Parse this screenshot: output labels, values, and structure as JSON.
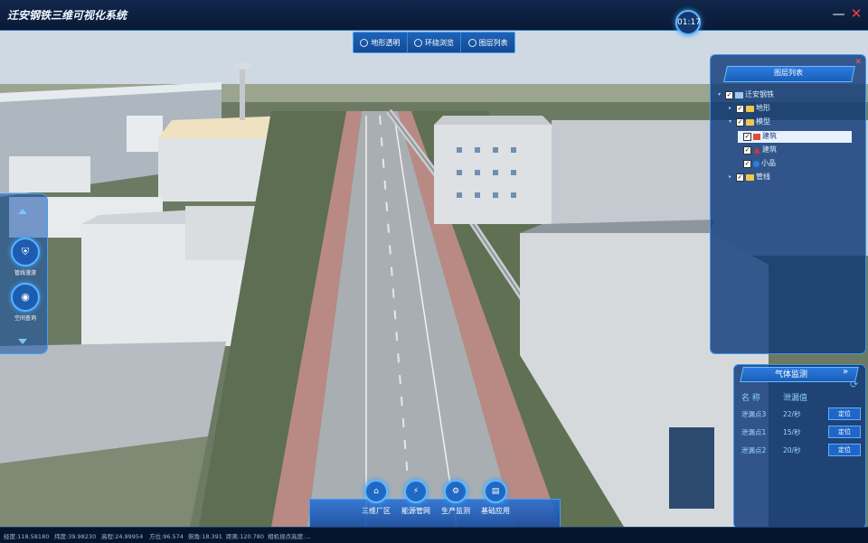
{
  "app": {
    "title": "迁安钢铁三维可视化系统",
    "clock": "01:17"
  },
  "window_controls": {
    "minimize": "—",
    "close": "✕"
  },
  "toolbar": [
    {
      "label": "地形透明",
      "icon": "terrain-icon"
    },
    {
      "label": "环绕浏览",
      "icon": "orbit-icon"
    },
    {
      "label": "图层列表",
      "icon": "layers-icon"
    }
  ],
  "left_nav": {
    "items": [
      {
        "label": "管线漫游",
        "icon": "pipeline-icon"
      },
      {
        "label": "空间查询",
        "icon": "eye-icon"
      }
    ]
  },
  "layer_panel": {
    "title": "图层列表",
    "close": "✕",
    "tree": [
      {
        "label": "迁安钢铁",
        "level": 0,
        "checked": true,
        "expanded": true,
        "icon": "root-icon"
      },
      {
        "label": "地形",
        "level": 1,
        "checked": true,
        "expanded": false,
        "icon": "folder-icon"
      },
      {
        "label": "模型",
        "level": 1,
        "checked": true,
        "expanded": true,
        "icon": "folder-icon"
      },
      {
        "label": "建筑",
        "level": 2,
        "checked": true,
        "expanded": false,
        "icon": "building-icon",
        "selected": true
      },
      {
        "label": "建筑",
        "level": 2,
        "checked": true,
        "expanded": false,
        "icon": "ship-icon"
      },
      {
        "label": "小品",
        "level": 2,
        "checked": true,
        "expanded": false,
        "icon": "small-item-icon"
      },
      {
        "label": "管线",
        "level": 1,
        "checked": true,
        "expanded": false,
        "icon": "folder-icon"
      }
    ]
  },
  "gas_panel": {
    "title": "气体监测",
    "arrow": "»",
    "columns": [
      "名 称",
      "泄漏值"
    ],
    "rows": [
      {
        "name": "泄漏点3",
        "value": "22/秒",
        "action": "定位"
      },
      {
        "name": "泄漏点1",
        "value": "15/秒",
        "action": "定位"
      },
      {
        "name": "泄漏点2",
        "value": "20/秒",
        "action": "定位"
      }
    ]
  },
  "bottom_nav": [
    {
      "label": "三维厂区",
      "icon": "factory-icon"
    },
    {
      "label": "能源管网",
      "icon": "energy-network-icon"
    },
    {
      "label": "生产监测",
      "icon": "production-monitor-icon"
    },
    {
      "label": "基础应用",
      "icon": "basic-app-icon"
    }
  ],
  "statusbar": {
    "longitude": "经度:118.58180",
    "latitude": "纬度:39.98230",
    "altitude": "高程:24.99954",
    "heading": "方位:96.574",
    "pitch": "俯角:18.391",
    "distance": "距离:120.780",
    "camera_height": "相机视点高度:..."
  },
  "colors": {
    "accent": "#2c7be0",
    "panel_border": "#3b96f0",
    "close_red": "#ff3b3b",
    "title_bg": "#0a1a36"
  }
}
